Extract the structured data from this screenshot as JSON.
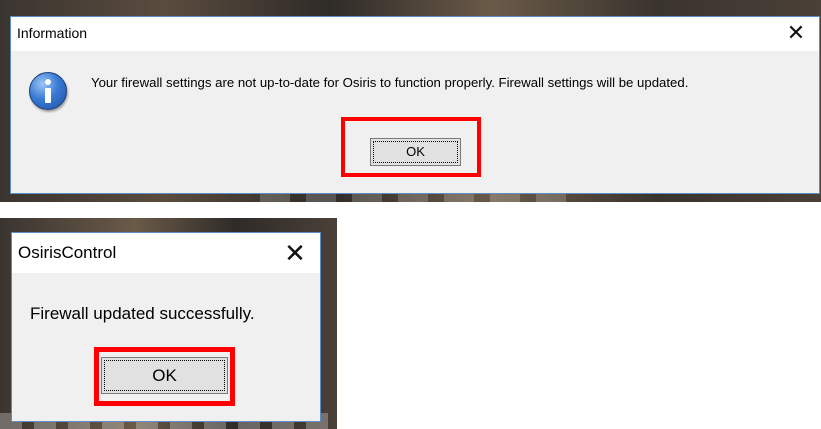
{
  "dialog_info": {
    "title": "Information",
    "close_glyph": "✕",
    "icon": "info-icon",
    "message": "Your firewall settings are not up-to-date for Osiris to function properly. Firewall settings will be updated.",
    "ok_label": "OK"
  },
  "dialog_control": {
    "title": "OsirisControl",
    "close_glyph": "✕",
    "message": "Firewall updated successfully.",
    "ok_label": "OK"
  },
  "colors": {
    "highlight": "#ff0000",
    "dialog_bg": "#f0f0f0",
    "button_bg": "#e1e1e1"
  }
}
